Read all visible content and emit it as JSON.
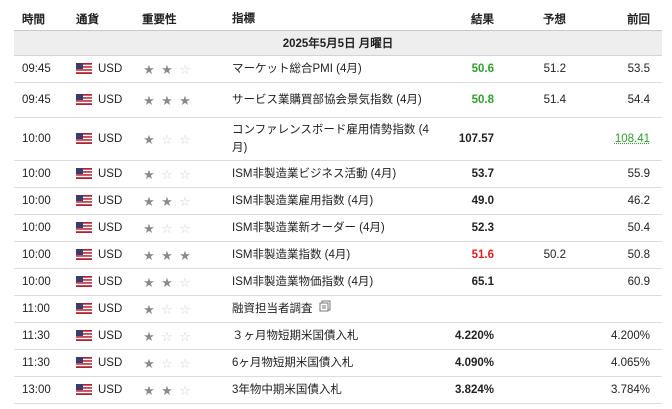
{
  "headers": {
    "time": "時間",
    "currency": "通貨",
    "importance": "重要性",
    "event": "指標",
    "actual": "結果",
    "forecast": "予想",
    "previous": "前回"
  },
  "date": "2025年5月5日 月曜日",
  "icons": {
    "flag": "us-flag-icon",
    "star_filled": "star-icon",
    "star_empty": "star-outline-icon",
    "memo": "document-icon"
  },
  "colors": {
    "green": "#2f9e2f",
    "red": "#e02020"
  },
  "rows": [
    {
      "time": "09:45",
      "currency": "USD",
      "importance": 2,
      "event": "マーケット総合PMI (4月)",
      "actual": "50.6",
      "actual_color": "green",
      "forecast": "51.2",
      "previous": "53.5",
      "previous_color": ""
    },
    {
      "time": "09:45",
      "currency": "USD",
      "importance": 3,
      "event": "サービス業購買部協会景気指数 (4月)",
      "actual": "50.8",
      "actual_color": "green",
      "forecast": "51.4",
      "previous": "54.4",
      "previous_color": ""
    },
    {
      "time": "10:00",
      "currency": "USD",
      "importance": 1,
      "event": "コンファレンスボード雇用情勢指数 (4月)",
      "actual": "107.57",
      "actual_color": "",
      "forecast": "",
      "previous": "108.41",
      "previous_color": "green"
    },
    {
      "time": "10:00",
      "currency": "USD",
      "importance": 1,
      "event": "ISM非製造業ビジネス活動 (4月)",
      "actual": "53.7",
      "actual_color": "",
      "forecast": "",
      "previous": "55.9",
      "previous_color": ""
    },
    {
      "time": "10:00",
      "currency": "USD",
      "importance": 2,
      "event": "ISM非製造業雇用指数 (4月)",
      "actual": "49.0",
      "actual_color": "",
      "forecast": "",
      "previous": "46.2",
      "previous_color": ""
    },
    {
      "time": "10:00",
      "currency": "USD",
      "importance": 1,
      "event": "ISM非製造業新オーダー (4月)",
      "actual": "52.3",
      "actual_color": "",
      "forecast": "",
      "previous": "50.4",
      "previous_color": ""
    },
    {
      "time": "10:00",
      "currency": "USD",
      "importance": 3,
      "event": "ISM非製造業指数 (4月)",
      "actual": "51.6",
      "actual_color": "red",
      "forecast": "50.2",
      "previous": "50.8",
      "previous_color": ""
    },
    {
      "time": "10:00",
      "currency": "USD",
      "importance": 2,
      "event": "ISM非製造業物価指数 (4月)",
      "actual": "65.1",
      "actual_color": "",
      "forecast": "",
      "previous": "60.9",
      "previous_color": ""
    },
    {
      "time": "11:00",
      "currency": "USD",
      "importance": 1,
      "event": "融資担当者調査",
      "actual": "",
      "actual_color": "",
      "forecast": "",
      "previous": "",
      "previous_color": "",
      "memo": true
    },
    {
      "time": "11:30",
      "currency": "USD",
      "importance": 1,
      "event": "３ヶ月物短期米国債入札",
      "actual": "4.220%",
      "actual_color": "",
      "forecast": "",
      "previous": "4.200%",
      "previous_color": ""
    },
    {
      "time": "11:30",
      "currency": "USD",
      "importance": 1,
      "event": "6ヶ月物短期米国債入札",
      "actual": "4.090%",
      "actual_color": "",
      "forecast": "",
      "previous": "4.065%",
      "previous_color": ""
    },
    {
      "time": "13:00",
      "currency": "USD",
      "importance": 2,
      "event": "3年物中期米国債入札",
      "actual": "3.824%",
      "actual_color": "",
      "forecast": "",
      "previous": "3.784%",
      "previous_color": ""
    }
  ]
}
